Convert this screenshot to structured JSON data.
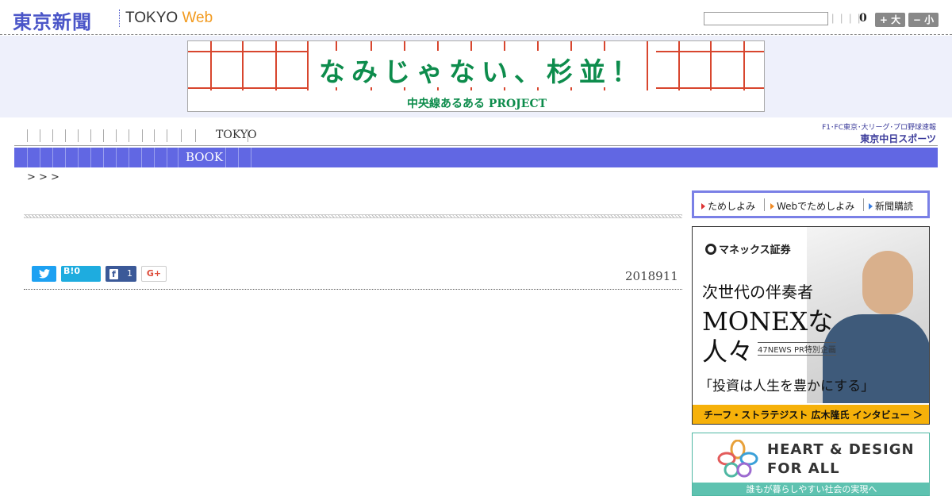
{
  "header": {
    "logo": "東京新聞",
    "logo_sub": "TOKYO ",
    "logo_web": "Web",
    "pipes": "| | | |",
    "count": "0",
    "font_bigger": "+ 大",
    "font_smaller": "− 小"
  },
  "banner": {
    "title": "なみじゃない、杉並！",
    "subtitle": "中央線あるある PROJECT"
  },
  "nav": {
    "primary_label": "TOKYO",
    "secondary_label": "BOOK",
    "sports_line1": "F1･FC東京･大リーグ･プロ野球速報",
    "sports_line2": "東京中日スポーツ"
  },
  "breadcrumb": ">    > >",
  "article": {
    "date": "2018911",
    "share_twitter_icon": "twitter-bird",
    "hatena_label": "B!0",
    "facebook_label": "f",
    "facebook_count": "1",
    "gplus_label": "G+"
  },
  "sidebar": {
    "try_links": [
      "ためしよみ",
      "Webでためしよみ",
      "新聞購読"
    ],
    "ad1": {
      "brand": "マネックス証券",
      "line1": "次世代の伴奏者",
      "line2": "MONEXな",
      "line3": "人々",
      "tag": "47NEWS PR特別企画",
      "quote": "「投資は人生を豊かにする」",
      "cta": "チーフ・ストラテジスト 広木隆氏 インタビュー ＞"
    },
    "ad2": {
      "line1": "HEART & DESIGN",
      "line2": "FOR ALL",
      "caption": "誰もが暮らしやすい社会の実現へ"
    }
  },
  "colors": {
    "brand_blue": "#4a55c8",
    "nav_bar": "#6167e3",
    "web_orange": "#f29a1e",
    "banner_green": "#0d8c4c",
    "banner_red": "#d8462e"
  }
}
